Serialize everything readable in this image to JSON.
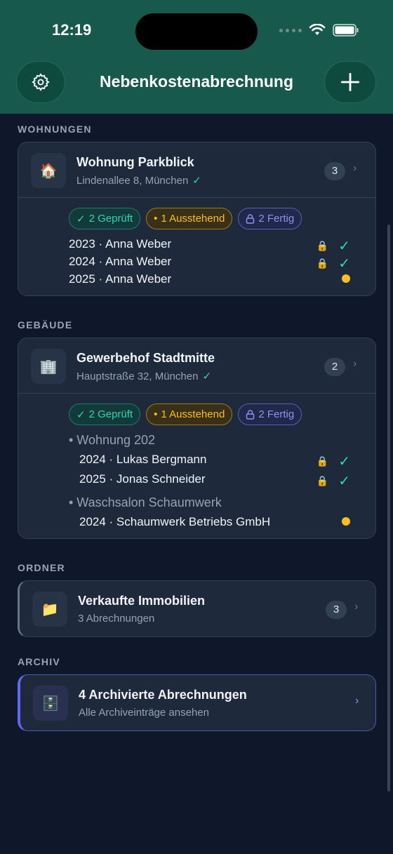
{
  "status": {
    "time": "12:19"
  },
  "header": {
    "title": "Nebenkostenabrechnung"
  },
  "sections": {
    "wohnungen": "WOHNUNGEN",
    "gebaeude": "GEBÄUDE",
    "ordner": "ORDNER",
    "archiv": "ARCHIV"
  },
  "apartment": {
    "title": "Wohnung Parkblick",
    "address": "Lindenallee 8, München",
    "count": "3",
    "tags": {
      "checked": "2 Geprüft",
      "pending": "1 Ausstehend",
      "done": "2 Fertig"
    },
    "rows": [
      {
        "label": "2023 · Anna Weber"
      },
      {
        "label": "2024 · Anna Weber"
      },
      {
        "label": "2025 · Anna Weber"
      }
    ]
  },
  "building": {
    "title": "Gewerbehof Stadtmitte",
    "address": "Hauptstraße 32, München",
    "count": "2",
    "tags": {
      "checked": "2 Geprüft",
      "pending": "1 Ausstehend",
      "done": "2 Fertig"
    },
    "groups": [
      {
        "label": "• Wohnung 202",
        "rows": [
          {
            "label": "2024 · Lukas Bergmann"
          },
          {
            "label": "2025 · Jonas Schneider"
          }
        ]
      },
      {
        "label": "• Waschsalon Schaumwerk",
        "rows": [
          {
            "label": "2024 · Schaumwerk Betriebs GmbH"
          }
        ]
      }
    ]
  },
  "folder": {
    "title": "Verkaufte Immobilien",
    "subtitle": "3 Abrechnungen",
    "count": "3"
  },
  "archive": {
    "title": "4 Archivierte Abrechnungen",
    "subtitle": "Alle Archiveinträge ansehen"
  },
  "colors": {
    "header": "#175a4d",
    "background": "#0f172a",
    "card": "#1e293b",
    "accent_green": "#2dd4bf",
    "pending": "#fbbf24",
    "done": "#8b93f0"
  }
}
